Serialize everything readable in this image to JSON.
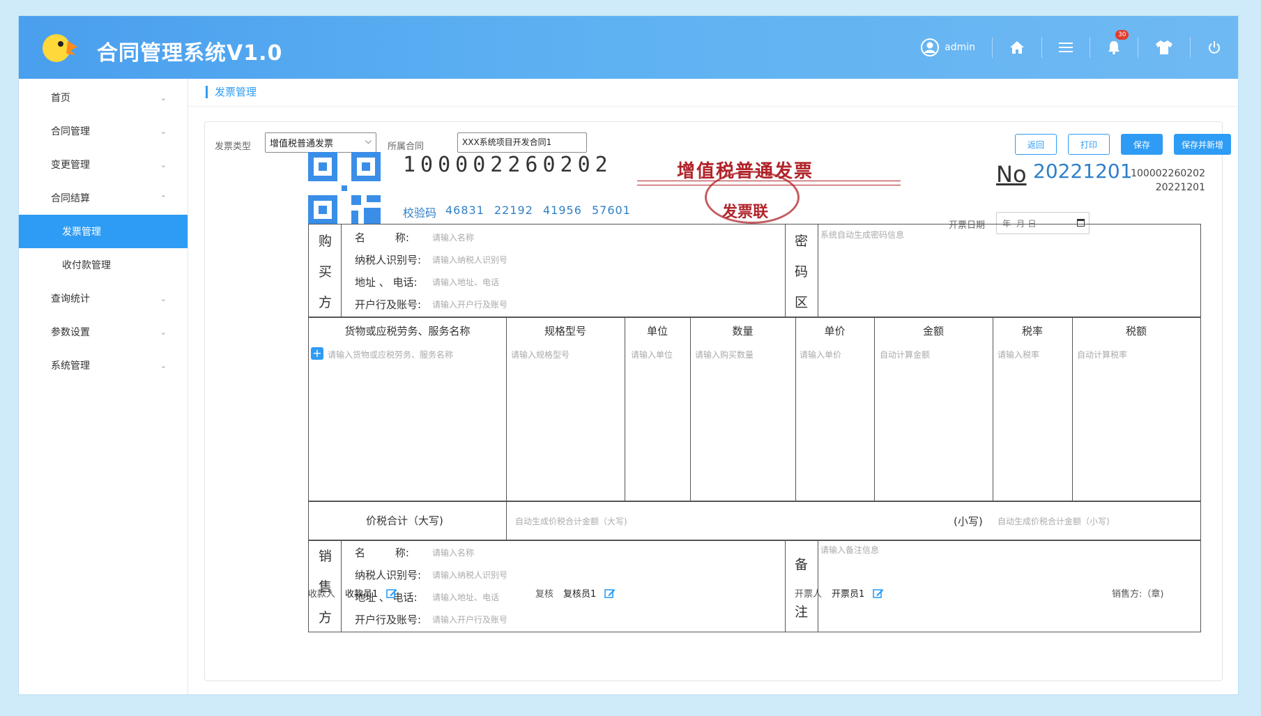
{
  "app": {
    "title": "合同管理系统V1.0"
  },
  "header": {
    "user": "admin",
    "notification_count": "30",
    "icons": [
      "user-icon",
      "home-icon",
      "menu-icon",
      "bell-icon",
      "shirt-icon",
      "power-icon"
    ]
  },
  "sidebar": {
    "items": [
      {
        "label": "首页"
      },
      {
        "label": "合同管理"
      },
      {
        "label": "变更管理"
      },
      {
        "label": "合同结算"
      },
      {
        "label": "发票管理"
      },
      {
        "label": "收付款管理"
      },
      {
        "label": "查询统计"
      },
      {
        "label": "参数设置"
      },
      {
        "label": "系统管理"
      }
    ]
  },
  "breadcrumb": "发票管理",
  "form": {
    "invoice_type_label": "发票类型",
    "invoice_type_value": "增值税普通发票",
    "contract_label": "所属合同",
    "contract_value": "XXX系统项目开发合同1",
    "buttons": {
      "back": "返回",
      "print": "打印",
      "save": "保存",
      "save_new": "保存并新增"
    }
  },
  "invoice": {
    "code": "100002260202",
    "check_label": "校验码",
    "check_code": "46831 22192 41956 57601",
    "title": "增值税普通发票",
    "subtitle": "发票联",
    "no_symbol": "No",
    "number": "20221201",
    "code_small": "100002260202",
    "number_small": "20221201",
    "date_label": "开票日期",
    "date_placeholder": "年 -月-日"
  },
  "buyer": {
    "label_chars": [
      "购",
      "买",
      "方"
    ],
    "rows": [
      {
        "label": "名         称:",
        "placeholder": "请输入名称"
      },
      {
        "label": "纳税人识别号:",
        "placeholder": "请输入纳税人识别号"
      },
      {
        "label": "地址 、 电话:",
        "placeholder": "请输入地址、电话"
      },
      {
        "label": "开户行及账号:",
        "placeholder": "请输入开户行及账号"
      }
    ]
  },
  "cipher": {
    "label_chars": [
      "密",
      "码",
      "区"
    ],
    "placeholder": "系统自动生成密码信息"
  },
  "items_table": {
    "headers": [
      "货物或应税劳务、服务名称",
      "规格型号",
      "单位",
      "数量",
      "单价",
      "金额",
      "税率",
      "税额"
    ],
    "placeholders": [
      "请输入货物或应税劳务、服务名称",
      "请输入规格型号",
      "请输入单位",
      "请输入购买数量",
      "请输入单价",
      "自动计算金额",
      "请输入税率",
      "自动计算税率"
    ]
  },
  "total": {
    "label": "价税合计（大写)",
    "upper_placeholder": "自动生成价税合计金额（大写)",
    "lower_label": "(小写)",
    "lower_placeholder": "自动生成价税合计金额（小写)"
  },
  "seller": {
    "label_chars": [
      "销",
      "售",
      "方"
    ],
    "rows": [
      {
        "label": "名         称:",
        "placeholder": "请输入名称"
      },
      {
        "label": "纳税人识别号:",
        "placeholder": "请输入纳税人识别号"
      },
      {
        "label": "地址 、 电话:",
        "placeholder": "请输入地址、电话"
      },
      {
        "label": "开户行及账号:",
        "placeholder": "请输入开户行及账号"
      }
    ]
  },
  "remark": {
    "label_chars": [
      "备",
      "注"
    ],
    "placeholder": "请输入备注信息"
  },
  "footer": {
    "payee_label": "收款人",
    "payee": "收款员1",
    "reviewer_label": "复核",
    "reviewer": "复核员1",
    "issuer_label": "开票人",
    "issuer": "开票员1",
    "seller_label": "销售方:（章)"
  },
  "colors": {
    "accent": "#2e9cf4",
    "red": "#b0242a",
    "blue_text": "#2e7fc9"
  }
}
